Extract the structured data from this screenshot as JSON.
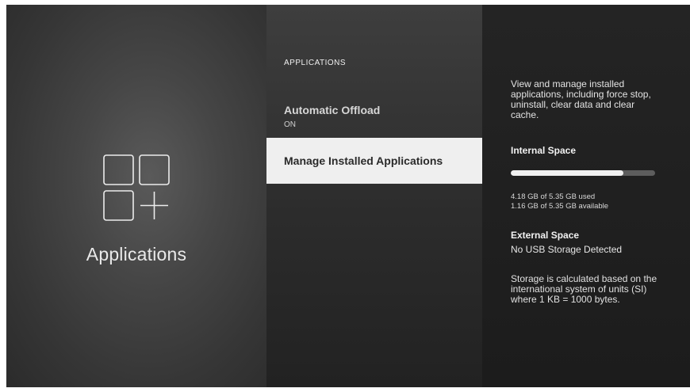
{
  "left": {
    "title": "Applications",
    "icon": "apps-grid-plus-icon"
  },
  "menu": {
    "header": "APPLICATIONS",
    "items": [
      {
        "label": "Automatic Offload",
        "value": "ON"
      },
      {
        "label": "Manage Installed Applications"
      }
    ],
    "selected_index": 1
  },
  "details": {
    "description": "View and manage installed applications, including force stop, uninstall, clear data and clear cache.",
    "internal": {
      "heading": "Internal Space",
      "used_fraction": 0.78,
      "used_text": "4.18 GB of 5.35 GB used",
      "available_text": "1.16 GB of 5.35 GB available"
    },
    "external": {
      "heading": "External Space",
      "value": "No USB Storage Detected"
    },
    "note": "Storage is calculated based on the international system of units (SI) where 1 KB = 1000 bytes."
  },
  "colors": {
    "selected_bg": "#efefef",
    "progress_fill": "#f0f0f0",
    "progress_track": "#5d5d5d"
  }
}
